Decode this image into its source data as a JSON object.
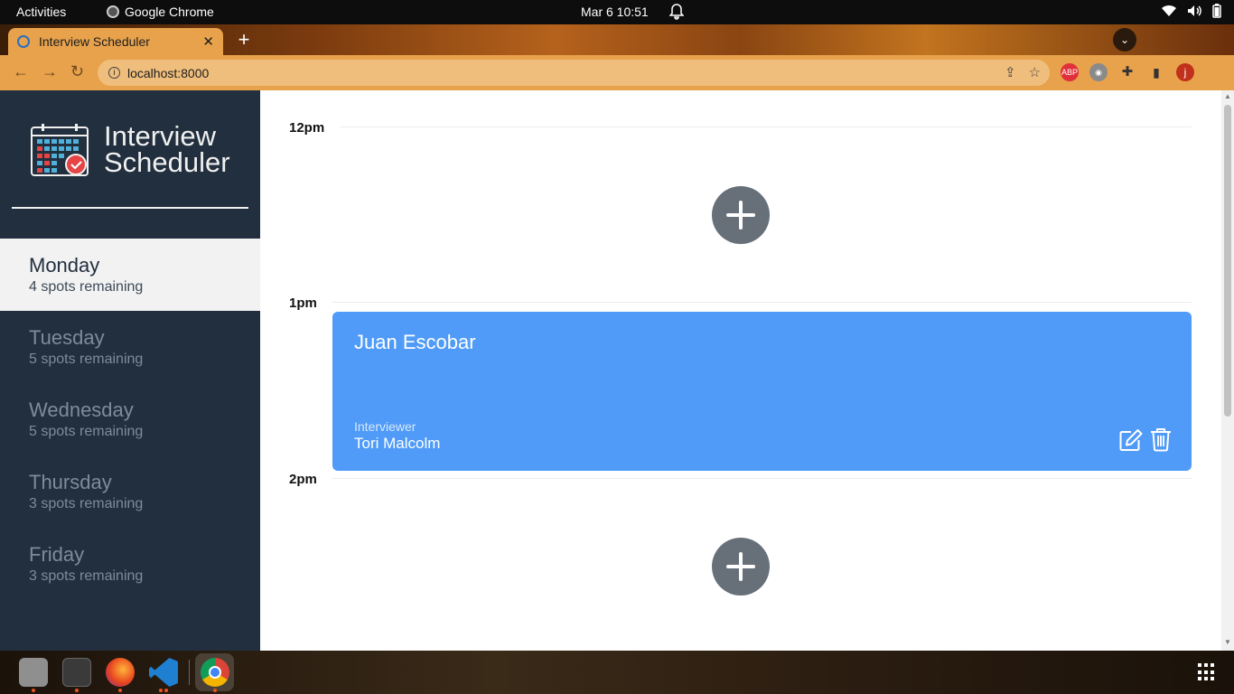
{
  "system_bar": {
    "activities": "Activities",
    "app_name": "Google Chrome",
    "datetime": "Mar 6  10:51"
  },
  "browser": {
    "tab_title": "Interview Scheduler",
    "url": "localhost:8000",
    "extension_abp": "ABP",
    "profile_initial": "j"
  },
  "app": {
    "brand_line1": "Interview",
    "brand_line2": "Scheduler",
    "days": [
      {
        "name": "Monday",
        "spots": "4 spots remaining"
      },
      {
        "name": "Tuesday",
        "spots": "5 spots remaining"
      },
      {
        "name": "Wednesday",
        "spots": "5 spots remaining"
      },
      {
        "name": "Thursday",
        "spots": "3 spots remaining"
      },
      {
        "name": "Friday",
        "spots": "3 spots remaining"
      }
    ],
    "selected_day": "Monday",
    "schedule": {
      "times": [
        "12pm",
        "1pm",
        "2pm"
      ],
      "appointment": {
        "student": "Juan Escobar",
        "interviewer_label": "Interviewer",
        "interviewer": "Tori Malcolm"
      }
    }
  },
  "colors": {
    "sidebar": "#222f3e",
    "appointment": "#4f9bf7",
    "add_button": "#676f79",
    "chrome_accent": "#e8a24c"
  }
}
